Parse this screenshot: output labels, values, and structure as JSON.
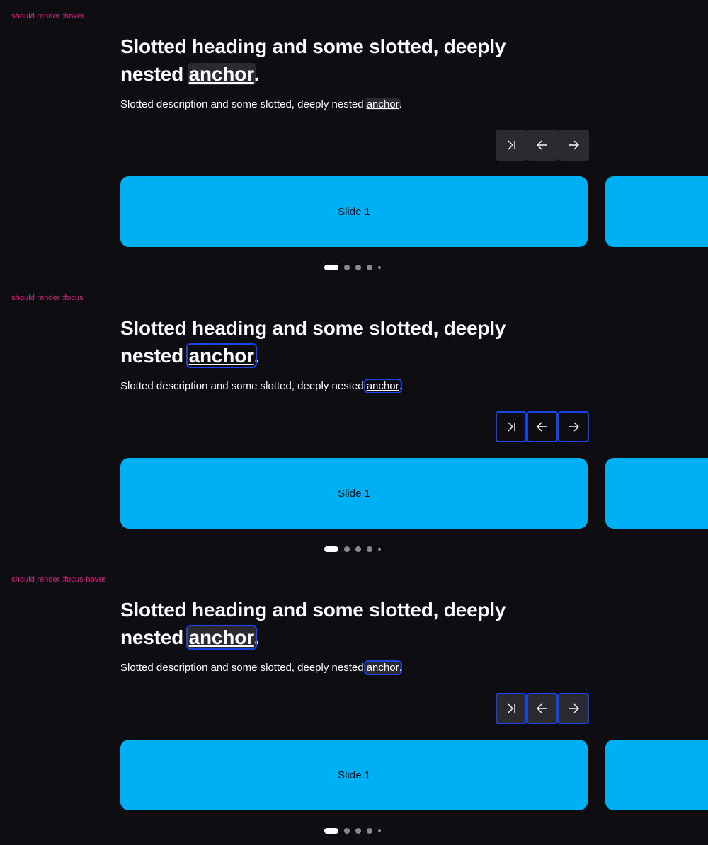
{
  "states": [
    {
      "label": "should render :hover",
      "heading_text": "Slotted heading and some slotted, deeply nested ",
      "heading_anchor": "anchor",
      "heading_end": ".",
      "desc_text": "Slotted description and some slotted, deeply nested ",
      "desc_anchor": "anchor",
      "desc_end": ".",
      "slide_label": "Slide 1"
    },
    {
      "label": "should render :focus",
      "heading_text": "Slotted heading and some slotted, deeply nested ",
      "heading_anchor": "anchor",
      "heading_end": ".",
      "desc_text": "Slotted description and some slotted, deeply nested ",
      "desc_anchor": "anchor",
      "desc_end": ".",
      "slide_label": "Slide 1"
    },
    {
      "label": "should render :focus-hover",
      "heading_text": "Slotted heading and some slotted, deeply nested ",
      "heading_anchor": "anchor",
      "heading_end": ".",
      "desc_text": "Slotted description and some slotted, deeply nested ",
      "desc_anchor": "anchor",
      "desc_end": ".",
      "slide_label": "Slide 1"
    }
  ],
  "nav": {
    "skip_icon": "skip-to-end-icon",
    "prev_icon": "arrow-left-icon",
    "next_icon": "arrow-right-icon"
  },
  "pagination": {
    "active_index": 0,
    "dot_count": 5
  },
  "colors": {
    "background": "#0e0e12",
    "slide": "#00b0f4",
    "focus_ring": "#1a44ea",
    "hover_bg": "#2a2a30",
    "label": "#e0218a",
    "text": "#fbfcff"
  }
}
